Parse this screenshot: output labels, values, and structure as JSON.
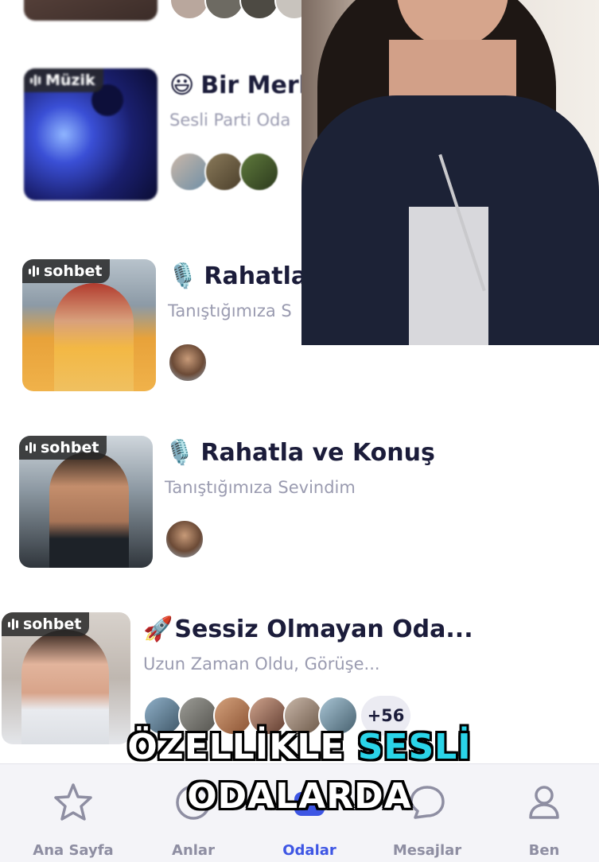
{
  "rooms": [
    {
      "tag": "",
      "emoji": "",
      "title": "",
      "subtitle": ""
    },
    {
      "tag": "Müzik",
      "emoji": "😃",
      "title": "Bir Merk",
      "subtitle": "Sesli Parti Oda"
    },
    {
      "tag": "sohbet",
      "emoji": "🎙️",
      "title": "Rahatla",
      "subtitle": "Tanıştığımıza S"
    },
    {
      "tag": "sohbet",
      "emoji": "🎙️",
      "title": "Rahatla ve Konuş",
      "subtitle": "Tanıştığımıza Sevindim"
    },
    {
      "tag": "sohbet",
      "emoji": "🚀",
      "title": "Sessiz Olmayan Oda...",
      "subtitle": "Uzun Zaman Oldu, Görüşe...",
      "more_count": "+56"
    }
  ],
  "caption": {
    "line1_a": "ÖZELLİKLE ",
    "line1_b": "SESLİ",
    "line2": "ODALARDA"
  },
  "nav": {
    "items": [
      {
        "label": "Ana Sayfa",
        "icon": "star-icon"
      },
      {
        "label": "Anlar",
        "icon": "moments-icon"
      },
      {
        "label": "Odalar",
        "icon": "rooms-icon"
      },
      {
        "label": "Mesajlar",
        "icon": "chat-icon"
      },
      {
        "label": "Ben",
        "icon": "user-icon"
      }
    ],
    "active": "Odalar",
    "active_color": "#3e56e4",
    "inactive_color": "#8e8ea2"
  },
  "colors": {
    "title": "#1b1c3a",
    "subtitle": "#9a9bb0",
    "caption_highlight": "#2ad4e8"
  }
}
